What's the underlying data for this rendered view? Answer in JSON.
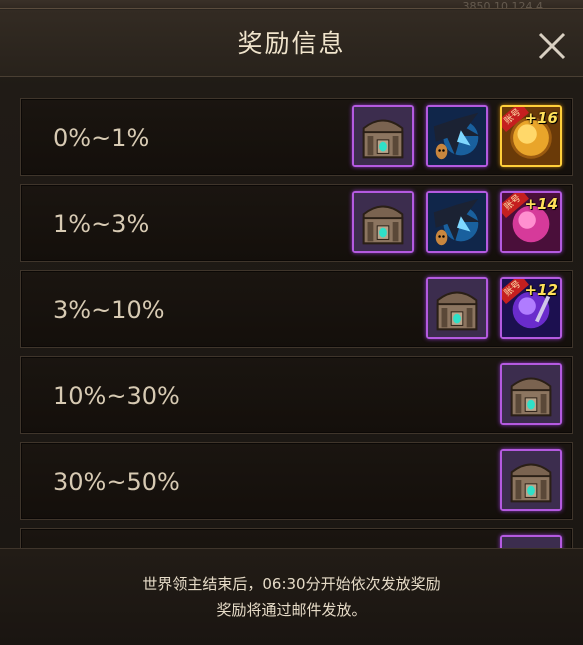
{
  "header": {
    "title": "奖励信息",
    "close_icon": "close-icon",
    "bg_blur_text": "3850 10  124 4"
  },
  "colors": {
    "frame_purple": "#b45ae0",
    "frame_gold": "#ffcf3a",
    "badge_red": "#c51f1f",
    "text_light": "#d7cab3"
  },
  "rows": [
    {
      "range": "0%~1%",
      "rewards": [
        {
          "icon": "treasure-chest-icon",
          "frame": "purple"
        },
        {
          "icon": "dark-dragon-icon",
          "frame": "purple"
        },
        {
          "icon": "gold-orb-icon",
          "frame": "gold",
          "badge": "账号",
          "plus": "+16"
        }
      ]
    },
    {
      "range": "1%~3%",
      "rewards": [
        {
          "icon": "treasure-chest-icon",
          "frame": "purple"
        },
        {
          "icon": "dark-dragon-icon",
          "frame": "purple"
        },
        {
          "icon": "pink-orb-icon",
          "frame": "purple",
          "badge": "账号",
          "plus": "+14"
        }
      ]
    },
    {
      "range": "3%~10%",
      "rewards": [
        {
          "icon": "treasure-chest-icon",
          "frame": "purple"
        },
        {
          "icon": "purple-orb-icon",
          "frame": "purple",
          "badge": "账号",
          "plus": "+12"
        }
      ]
    },
    {
      "range": "10%~30%",
      "rewards": [
        {
          "icon": "treasure-chest-icon",
          "frame": "purple"
        }
      ]
    },
    {
      "range": "30%~50%",
      "rewards": [
        {
          "icon": "treasure-chest-icon",
          "frame": "purple"
        }
      ]
    },
    {
      "range": "",
      "rewards": [
        {
          "icon": "treasure-chest-icon",
          "frame": "purple"
        }
      ]
    }
  ],
  "footer": {
    "line1": "世界领主结束后，06:30分开始依次发放奖励",
    "line2": "奖励将通过邮件发放。"
  }
}
